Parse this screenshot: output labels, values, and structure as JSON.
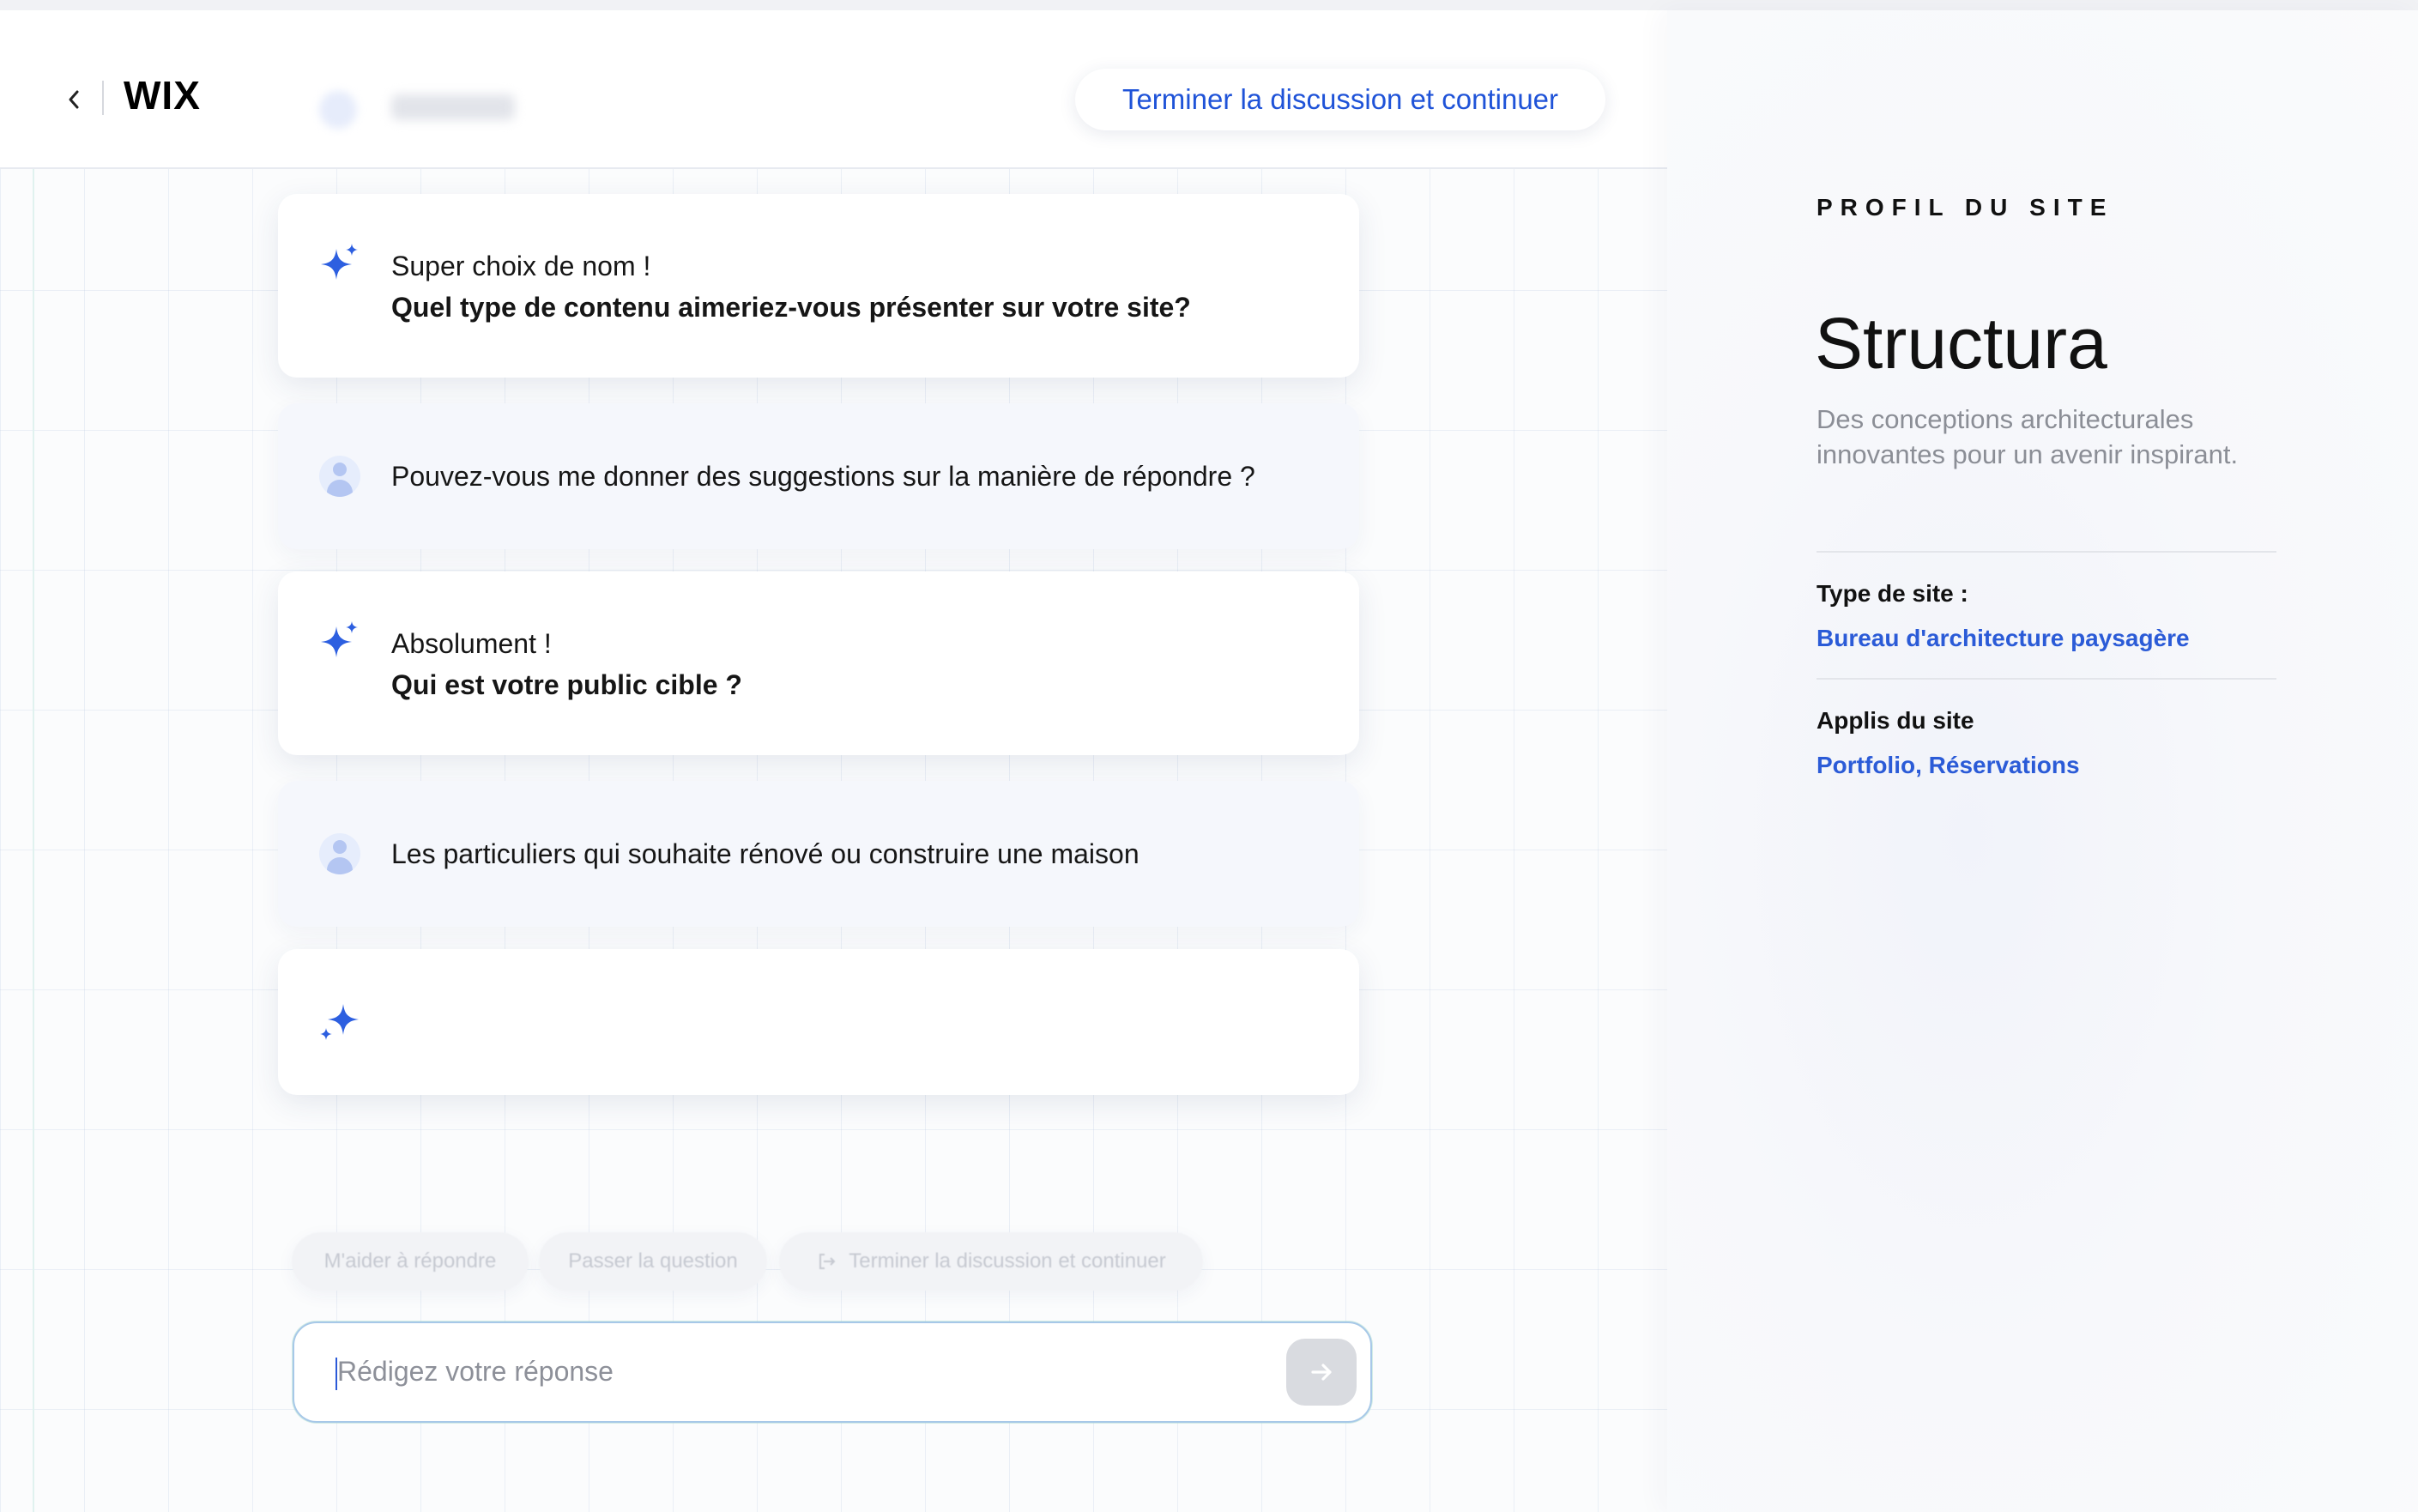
{
  "header": {
    "logo": "WIX",
    "end_button_label": "Terminer la discussion et continuer"
  },
  "chat": {
    "messages": [
      {
        "role": "assistant",
        "normal": "Super choix de nom !",
        "bold": "Quel type de contenu aimeriez-vous présenter sur votre site?"
      },
      {
        "role": "user",
        "text": "Pouvez-vous me donner des suggestions sur la manière de répondre ?"
      },
      {
        "role": "assistant",
        "normal": "Absolument !",
        "bold": "Qui est votre public cible ?"
      },
      {
        "role": "user",
        "text": "Les particuliers qui souhaite rénové ou construire une maison"
      },
      {
        "role": "assistant",
        "normal": "",
        "bold": ""
      }
    ],
    "suggestions": [
      "M'aider à répondre",
      "Passer la question",
      "Terminer la discussion et continuer"
    ],
    "input": {
      "placeholder": "Rédigez votre réponse",
      "value": ""
    }
  },
  "profile": {
    "section_label": "PROFIL DU SITE",
    "site_name": "Structura",
    "tagline": "Des conceptions architecturales innovantes pour un avenir inspirant.",
    "site_type_label": "Type de site :",
    "site_type_value": "Bureau d'architecture paysagère",
    "apps_label": "Applis du site",
    "apps_value": "Portfolio, Réservations"
  },
  "icons": {
    "back": "chevron-left-icon",
    "assistant": "sparkle-icon",
    "user": "user-avatar-icon",
    "send": "arrow-right-icon",
    "exit": "exit-icon"
  },
  "colors": {
    "accent": "#1f53d8",
    "link": "#2b5bd7",
    "muted_text": "#8b8e96"
  }
}
